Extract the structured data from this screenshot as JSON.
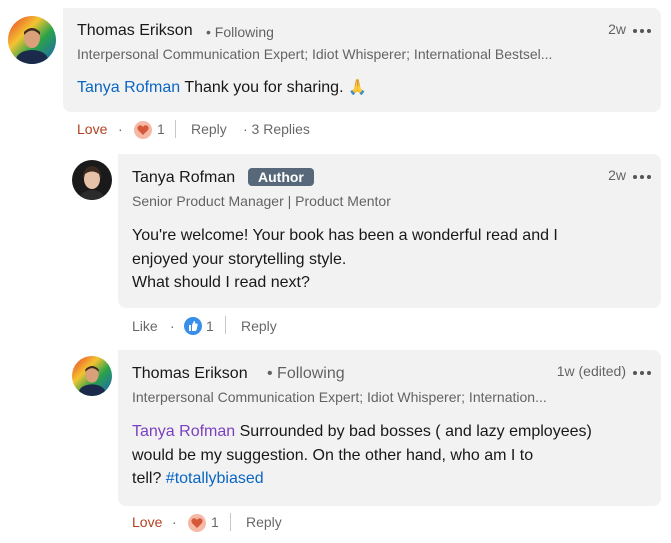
{
  "comment1": {
    "author": "Thomas Erikson",
    "following": "• Following",
    "headline": "Interpersonal Communication Expert; Idiot Whisperer; International Bestsel...",
    "time": "2w",
    "mention": "Tanya Rofman",
    "text": " Thank you for sharing.",
    "emoji": "🙏",
    "actions": {
      "love": "Love",
      "sep": "·",
      "reaction_count": "1",
      "reply": "Reply",
      "replies": "· 3 Replies"
    }
  },
  "reply1": {
    "author": "Tanya Rofman",
    "badge": "Author",
    "headline": "Senior Product Manager | Product Mentor",
    "time": "2w",
    "text_line1": "You're welcome! Your book has been a wonderful read and I",
    "text_line2": "enjoyed your storytelling style.",
    "text_line3": "What should I read next?",
    "actions": {
      "like": "Like",
      "sep": "·",
      "reaction_count": "1",
      "reply": "Reply"
    }
  },
  "reply2": {
    "author": "Thomas Erikson",
    "following": "• Following",
    "headline": "Interpersonal Communication Expert; Idiot Whisperer; Internation...",
    "time": "1w (edited)",
    "mention": "Tanya Rofman",
    "text_line1": " Surrounded by bad bosses ( and lazy employees)",
    "text_line2": "would be my suggestion. On the other hand, who am I to",
    "text_line3_prefix": "tell? ",
    "hashtag": "#totallybiased",
    "actions": {
      "love": "Love",
      "sep": "·",
      "reaction_count": "1",
      "reply": "Reply"
    }
  },
  "icons": {
    "more": "more-options-icon",
    "love_reaction": "heart-reaction-icon",
    "like_reaction": "thumbs-up-reaction-icon"
  },
  "colors": {
    "bubble": "#f2f2f2",
    "love": "#b24020",
    "link": "#0a66c2",
    "mention_purple": "#7b3fbf",
    "author_badge": "#56687a"
  }
}
